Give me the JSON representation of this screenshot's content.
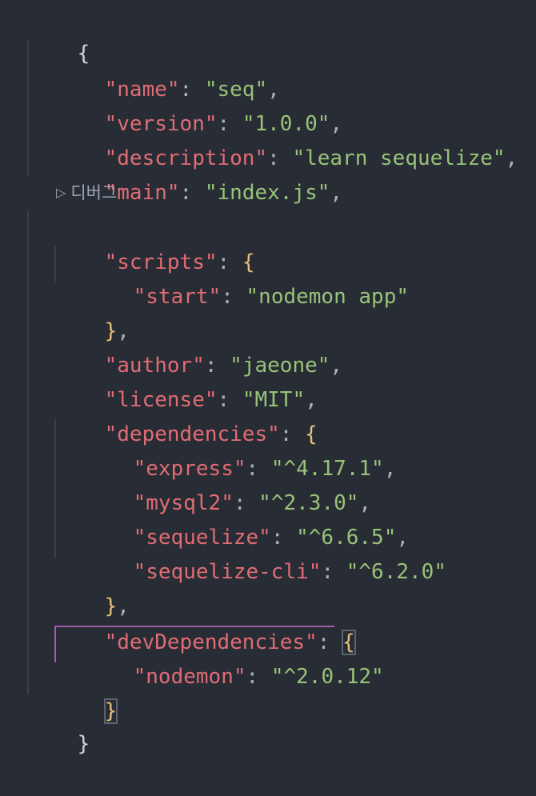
{
  "editor": {
    "codelens_label": "디버그",
    "lines": [
      {
        "brace": "{"
      },
      {
        "key": "\"name\"",
        "sep": ": ",
        "value": "\"seq\"",
        "trail": ","
      },
      {
        "key": "\"version\"",
        "sep": ": ",
        "value": "\"1.0.0\"",
        "trail": ","
      },
      {
        "key": "\"description\"",
        "sep": ": ",
        "value": "\"learn sequelize\"",
        "trail": ","
      },
      {
        "key": "\"main\"",
        "sep": ": ",
        "value": "\"index.js\"",
        "trail": ","
      },
      {
        "key": "\"scripts\"",
        "sep": ": ",
        "open": "{"
      },
      {
        "key": "\"start\"",
        "sep": ": ",
        "value": "\"nodemon app\""
      },
      {
        "close": "}",
        "trail": ","
      },
      {
        "key": "\"author\"",
        "sep": ": ",
        "value": "\"jaeone\"",
        "trail": ","
      },
      {
        "key": "\"license\"",
        "sep": ": ",
        "value": "\"MIT\"",
        "trail": ","
      },
      {
        "key": "\"dependencies\"",
        "sep": ": ",
        "open": "{"
      },
      {
        "key": "\"express\"",
        "sep": ": ",
        "value": "\"^4.17.1\"",
        "trail": ","
      },
      {
        "key": "\"mysql2\"",
        "sep": ": ",
        "value": "\"^2.3.0\"",
        "trail": ","
      },
      {
        "key": "\"sequelize\"",
        "sep": ": ",
        "value": "\"^6.6.5\"",
        "trail": ","
      },
      {
        "key": "\"sequelize-cli\"",
        "sep": ": ",
        "value": "\"^6.2.0\""
      },
      {
        "close": "}",
        "trail": ","
      },
      {
        "key": "\"devDependencies\"",
        "sep": ": ",
        "open": "{"
      },
      {
        "key": "\"nodemon\"",
        "sep": ": ",
        "value": "\"^2.0.12\""
      },
      {
        "close": "}"
      },
      {
        "brace": "}"
      }
    ]
  },
  "colors": {
    "background": "#282c34",
    "key": "#e06c75",
    "string": "#98c379",
    "bracket": "#e5c07b",
    "scope_highlight": "#a35ca8"
  }
}
